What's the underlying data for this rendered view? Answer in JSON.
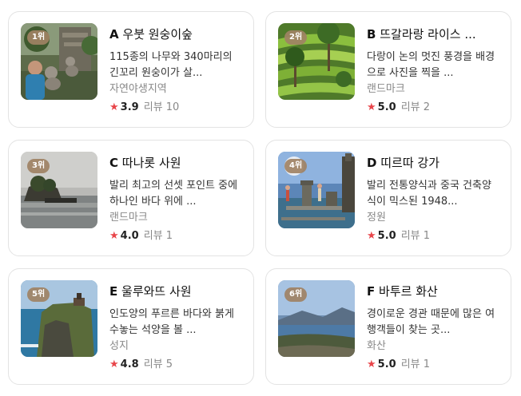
{
  "accent_star": "#e8454a",
  "rank_badge_color": "#a08264",
  "review_label": "리뷰",
  "star_icon": "★",
  "places": [
    {
      "rank": "1위",
      "letter": "A",
      "name": "우붓 원숭이숲",
      "desc": "115종의 나무와 340마리의 긴꼬리 원숭이가 살...",
      "category": "자연야생지역",
      "score": "3.9",
      "reviews": "10",
      "image": "monkey-forest"
    },
    {
      "rank": "2위",
      "letter": "B",
      "name": "뜨갈라랑 라이스 ...",
      "desc": "다랑이 논의 멋진 풍경을 배경으로 사진을 찍을 ...",
      "category": "랜드마크",
      "score": "5.0",
      "reviews": "2",
      "image": "rice-terrace"
    },
    {
      "rank": "3위",
      "letter": "C",
      "name": "따나롯 사원",
      "desc": "발리 최고의 선셋 포인트 중에 하나인 바다 위에 ...",
      "category": "랜드마크",
      "score": "4.0",
      "reviews": "1",
      "image": "sea-temple"
    },
    {
      "rank": "4위",
      "letter": "D",
      "name": "띠르따 강가",
      "desc": "발리 전통양식과 중국 건축양식이 믹스된 1948...",
      "category": "정원",
      "score": "5.0",
      "reviews": "1",
      "image": "water-palace"
    },
    {
      "rank": "5위",
      "letter": "E",
      "name": "울루와뜨 사원",
      "desc": "인도양의 푸르른 바다와 붉게 수놓는 석양을 볼 ...",
      "category": "성지",
      "score": "4.8",
      "reviews": "5",
      "image": "cliff-temple"
    },
    {
      "rank": "6위",
      "letter": "F",
      "name": "바투르 화산",
      "desc": "경이로운 경관 때문에 많은 여행객들이 찾는 곳...",
      "category": "화산",
      "score": "5.0",
      "reviews": "1",
      "image": "volcano-lake"
    }
  ]
}
